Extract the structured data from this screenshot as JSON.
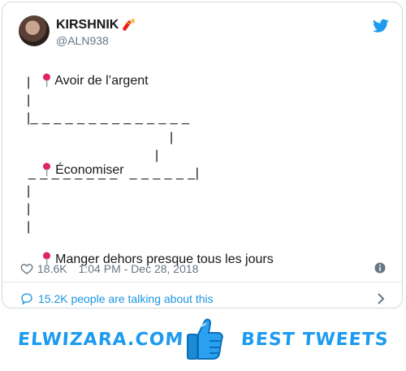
{
  "tweet": {
    "display_name": "KIRSHNIK",
    "display_name_emoji": "🧨",
    "handle": "@ALN938",
    "lines": [
      "Avoir de l’argent",
      "|",
      "|",
      "|_ _ _ _ _ _ _ _ _ _ _ _ _ _",
      "|",
      "Économiser",
      "|",
      "_ _ _ _ _ _ _ _   _ _ _ _ _ _|",
      "|",
      "|",
      "|",
      "Manger dehors presque tous les jours"
    ],
    "likes": "18.6K",
    "timestamp": "1:04 PM - Dec 28, 2018",
    "talking": "15.2K people are talking about this"
  },
  "footer": {
    "brand": "ELWIZARA.COM",
    "tagline": "BEST TWEETS"
  },
  "colors": {
    "accent": "#1d9bf0",
    "muted": "#657786",
    "pin": "#e0245e"
  },
  "icons": [
    "twitter-bird-icon",
    "pin-icon",
    "heart-icon",
    "info-icon",
    "speech-bubble-icon",
    "chevron-right-icon",
    "thumbs-up-icon"
  ]
}
